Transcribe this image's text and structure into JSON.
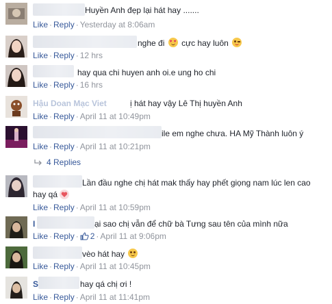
{
  "labels": {
    "like": "Like",
    "reply": "Reply",
    "dot": "·"
  },
  "comments": [
    {
      "text": "Huyền Anh đẹp lại hát hay .......",
      "time": "Yesterday at 8:06am"
    },
    {
      "text_before": "nghe đi",
      "text_after": "cực hay luôn",
      "time": "12 hrs"
    },
    {
      "text": "hay qua chi huyen anh oi.e ung ho chi",
      "time": "16 hrs"
    },
    {
      "name_fragment": "Hậu Doan Mạc Viet",
      "text": "ị hát hay vậy Lê Thị huyền Anh",
      "time": "April 11 at 10:49pm"
    },
    {
      "text": "ile em nghe chưa. HA Mỹ Thành luôn ý",
      "time": "April 11 at 10:21pm"
    },
    {
      "text_line1": "Lần đầu nghe chị hát mak thấy hay phết giọng nam lúc len cao",
      "text_line2": "hay qá",
      "time": "April 11 at 10:59pm"
    },
    {
      "name_initial": "I",
      "text": "ại sao chị vẫn để chữ bà Tưng sau tên của mình nữa",
      "likes": "2",
      "time": "April 11 at 9:06pm"
    },
    {
      "text": "vèo hát hay",
      "time": "April 11 at 10:45pm"
    },
    {
      "name_initial": "S",
      "text": "hay qá chị ơi !",
      "time": "April 11 at 11:41pm"
    }
  ],
  "replies_link": "4 Replies",
  "colors": {
    "link": "#365899",
    "meta": "#90949c",
    "text": "#1d2129"
  }
}
